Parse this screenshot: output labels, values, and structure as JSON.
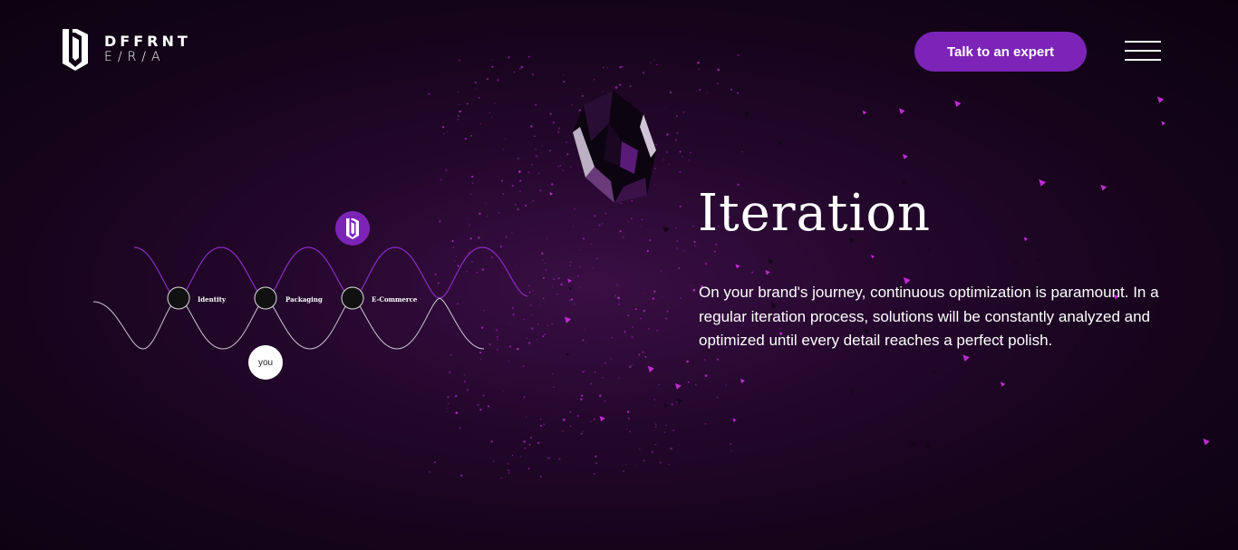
{
  "header": {
    "logo_line1": "DFFRNT",
    "logo_line2": "E/R/A",
    "cta_label": "Talk to an expert"
  },
  "section": {
    "title": "Iteration",
    "paragraph": "On your brand's journey, continuous optimization is paramount. In a regular iteration process, solutions will be constantly analyzed and optimized until every detail reaches a perfect polish."
  },
  "journey": {
    "nodes": [
      "Identity",
      "Packaging",
      "E-Commerce"
    ],
    "you_label": "you"
  },
  "colors": {
    "accent": "#7c24b8",
    "background": "#1a0520",
    "wave_top": "#8a2bc2",
    "wave_bottom": "#cfc6d6"
  },
  "icons": {
    "logo": "dffrnt-logo-icon",
    "menu": "hamburger-menu-icon",
    "brand_badge": "dffrnt-badge-icon"
  }
}
